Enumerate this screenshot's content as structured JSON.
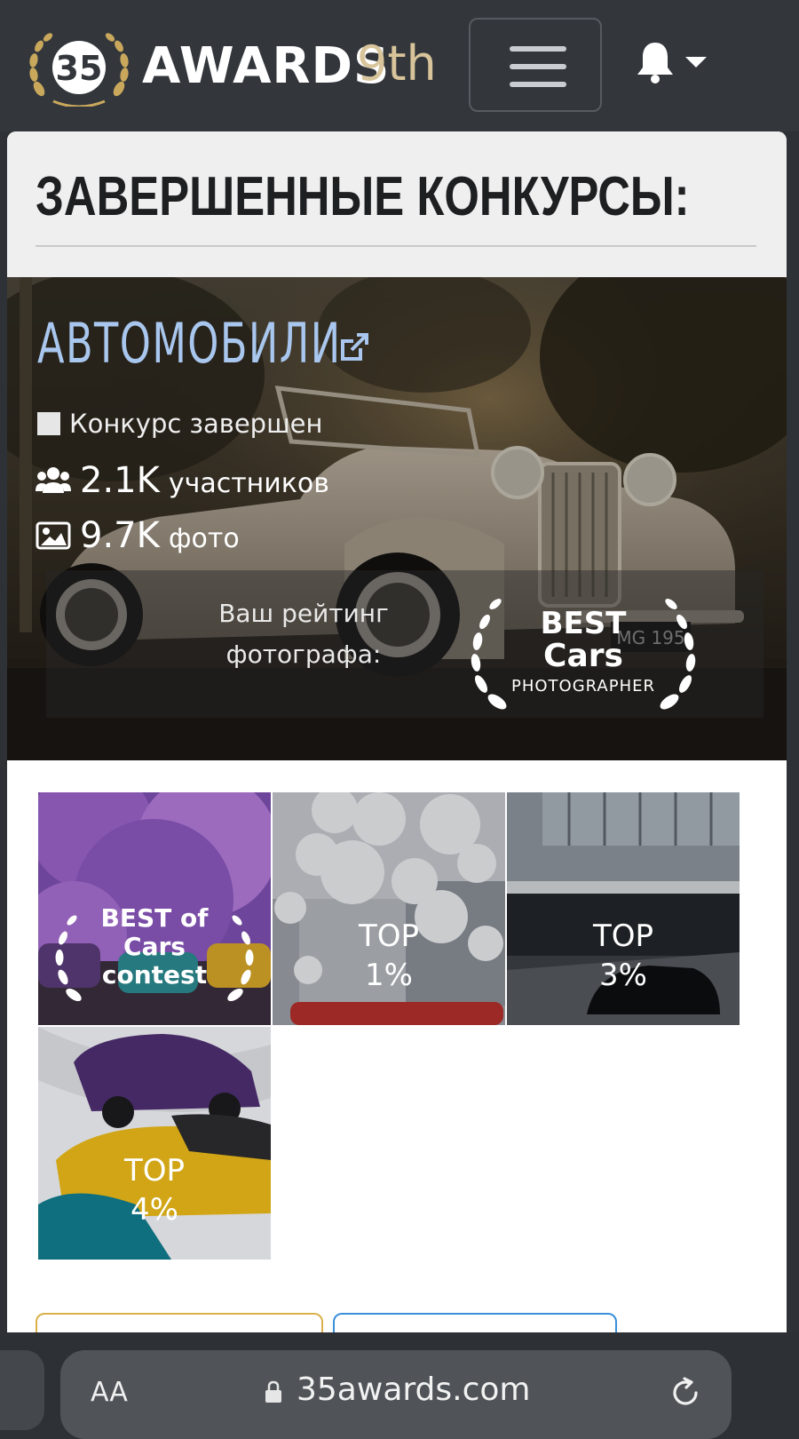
{
  "header": {
    "logo_text": "35",
    "brand_name": "AWARDS",
    "edition": "9th"
  },
  "section": {
    "title": "ЗАВЕРШЕННЫЕ КОНКУРСЫ:"
  },
  "contest": {
    "title": "АВТОМОБИЛИ",
    "status": "Конкурс завершен",
    "participants_count": "2.1K",
    "participants_label": "участников",
    "photos_count": "9.7K",
    "photos_label": "фото",
    "rating_label": "Ваш рейтинг фотографа:",
    "badge": {
      "line1": "BEST",
      "line2": "Cars",
      "line3": "PHOTOGRAPHER"
    },
    "plate_text": "MG 195"
  },
  "awards": [
    {
      "lines": [
        "BEST of",
        "Cars",
        "contest"
      ]
    },
    {
      "lines": [
        "TOP",
        "1%"
      ]
    },
    {
      "lines": [
        "TOP",
        "3%"
      ]
    },
    {
      "lines": [
        "TOP",
        "4%"
      ]
    }
  ],
  "browser": {
    "text_size_label": "AA",
    "url": "35awards.com"
  },
  "colors": {
    "navbar": "#33373c",
    "brand_gold": "#d8c49a",
    "contest_title": "#a9c7ee",
    "button_gold": "#d9b14a",
    "button_blue": "#3a8fd8"
  },
  "icons": [
    "laurel-logo-icon",
    "hamburger-menu-icon",
    "bell-icon",
    "chevron-down-icon",
    "external-link-icon",
    "users-icon",
    "image-icon",
    "laurel-icon",
    "lock-icon",
    "reload-icon"
  ]
}
